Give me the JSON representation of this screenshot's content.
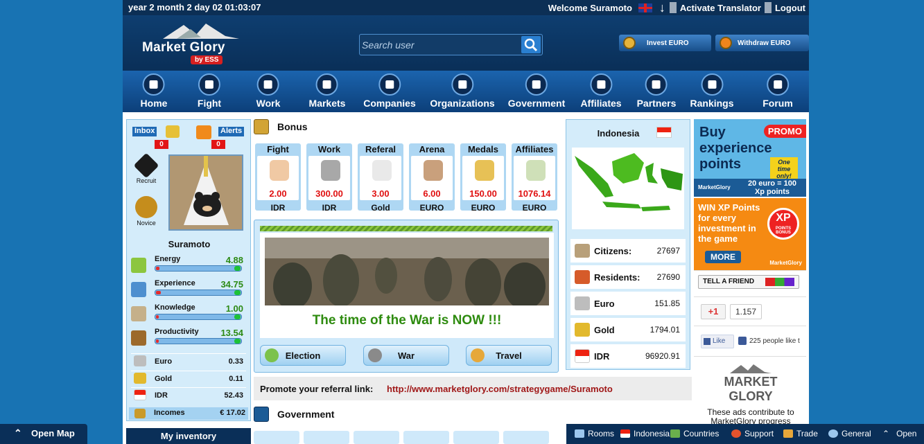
{
  "topbar": {
    "datetime": "year 2 month 2 day 02   01:03:07",
    "welcome": "Welcome Suramoto",
    "activate_translator": "Activate Translator",
    "logout": "Logout"
  },
  "header": {
    "logo_text": "Market Glory",
    "logo_sub": "by ESS",
    "search_placeholder": "Search user",
    "invest_label": "Invest EURO",
    "withdraw_label": "Withdraw EURO"
  },
  "nav": [
    {
      "label": "Home",
      "icon": "home-icon"
    },
    {
      "label": "Fight",
      "icon": "fight-icon"
    },
    {
      "label": "Work",
      "icon": "work-icon"
    },
    {
      "label": "Markets",
      "icon": "markets-icon"
    },
    {
      "label": "Companies",
      "icon": "companies-icon"
    },
    {
      "label": "Organizations",
      "icon": "organizations-icon"
    },
    {
      "label": "Government",
      "icon": "government-icon"
    },
    {
      "label": "Affiliates",
      "icon": "affiliates-icon"
    },
    {
      "label": "Partners",
      "icon": "partners-icon"
    },
    {
      "label": "Rankings",
      "icon": "rankings-icon"
    },
    {
      "label": "Forum",
      "icon": "forum-icon"
    }
  ],
  "profile": {
    "inbox_label": "Inbox",
    "inbox_count": "0",
    "alerts_label": "Alerts",
    "alerts_count": "0",
    "rank1": "Recruit",
    "rank2": "Novice",
    "username": "Suramoto",
    "stats": [
      {
        "label": "Energy",
        "value": "4.88",
        "fill": 0.04
      },
      {
        "label": "Experience",
        "value": "34.75",
        "fill": 0.06
      },
      {
        "label": "Knowledge",
        "value": "1.00",
        "fill": 0.03
      },
      {
        "label": "Productivity",
        "value": "13.54",
        "fill": 0.03
      }
    ],
    "resources": [
      {
        "label": "Euro",
        "value": "0.33"
      },
      {
        "label": "Gold",
        "value": "0.11"
      },
      {
        "label": "IDR",
        "value": "52.43"
      }
    ],
    "incomes_label": "Incomes",
    "incomes_value": "€ 17.02",
    "my_inventory": "My inventory"
  },
  "bonus": {
    "title": "Bonus",
    "items": [
      {
        "label": "Fight",
        "value": "2.00",
        "currency": "IDR"
      },
      {
        "label": "Work",
        "value": "300.00",
        "currency": "IDR"
      },
      {
        "label": "Referal",
        "value": "3.00",
        "currency": "Gold"
      },
      {
        "label": "Arena",
        "value": "6.00",
        "currency": "EURO"
      },
      {
        "label": "Medals",
        "value": "150.00",
        "currency": "EURO"
      },
      {
        "label": "Affiliates",
        "value": "1076.14",
        "currency": "EURO"
      }
    ]
  },
  "war": {
    "headline": "The time of the War is NOW !!!",
    "buttons": [
      "Election",
      "War",
      "Travel"
    ]
  },
  "promote": {
    "label": "Promote your referral link:",
    "link": "http://www.marketglory.com/strategygame/Suramoto"
  },
  "government": {
    "title": "Government"
  },
  "country": {
    "name": "Indonesia",
    "rows": [
      {
        "label": "Citizens:",
        "value": "27697"
      },
      {
        "label": "Residents:",
        "value": "27690"
      },
      {
        "label": "Euro",
        "value": "151.85"
      },
      {
        "label": "Gold",
        "value": "1794.01"
      },
      {
        "label": "IDR",
        "value": "96920.91"
      }
    ]
  },
  "ads": {
    "promo_tag": "PROMO",
    "promo_title": "Buy experience points",
    "promo_once": "One time only!",
    "promo_logo": "MarketGlory",
    "promo_rate": "20 euro = 100 Xp points",
    "xp_title": "WIN XP Points for every investment in the game",
    "xp_badge": "XP",
    "xp_badge_sub": "POINTS BONUS",
    "xp_more": "MORE",
    "xp_logo": "MarketGlory",
    "tell_friend": "TELL A FRIEND",
    "gplus": "+1",
    "gplus_count": "1.157",
    "fb_like": "Like",
    "fb_text": "225 people like t",
    "mg_banner": "MARKET GLORY",
    "mg_text": "These ads contribute to MarketGlory progress"
  },
  "bottombar": {
    "open_map": "Open Map",
    "items": [
      "Rooms",
      "Indonesia",
      "Countries",
      "Support",
      "Trade",
      "General",
      "Open"
    ]
  },
  "colors": {
    "background": "#1873b3",
    "navy": "#0a2f58",
    "panel": "#d4ecfa",
    "bonus_red": "#e01010",
    "war_green": "#2e8b0f"
  }
}
